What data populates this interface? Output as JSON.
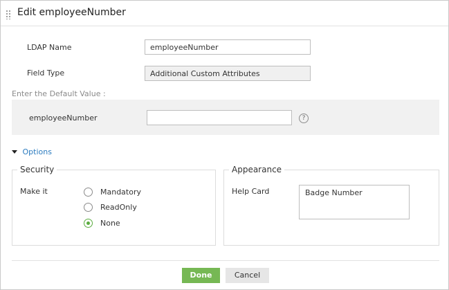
{
  "dialog": {
    "title": "Edit employeeNumber"
  },
  "form": {
    "ldap_name_label": "LDAP Name",
    "ldap_name_value": "employeeNumber",
    "field_type_label": "Field Type",
    "field_type_value": "Additional Custom Attributes"
  },
  "default_value": {
    "section_title": "Enter the Default Value :",
    "field_label": "employeeNumber",
    "field_value": "",
    "help_icon": "question-circle-icon"
  },
  "options": {
    "toggle_label": "Options",
    "expanded": true
  },
  "security": {
    "legend": "Security",
    "make_it_label": "Make it",
    "choices": [
      "Mandatory",
      "ReadOnly",
      "None"
    ],
    "selected": "None"
  },
  "appearance": {
    "legend": "Appearance",
    "help_card_label": "Help Card",
    "help_card_value": "Badge Number"
  },
  "footer": {
    "done_label": "Done",
    "cancel_label": "Cancel"
  },
  "colors": {
    "accent_green": "#76b854",
    "link_blue": "#2b7bbf",
    "panel_gray": "#f1f1f1"
  }
}
